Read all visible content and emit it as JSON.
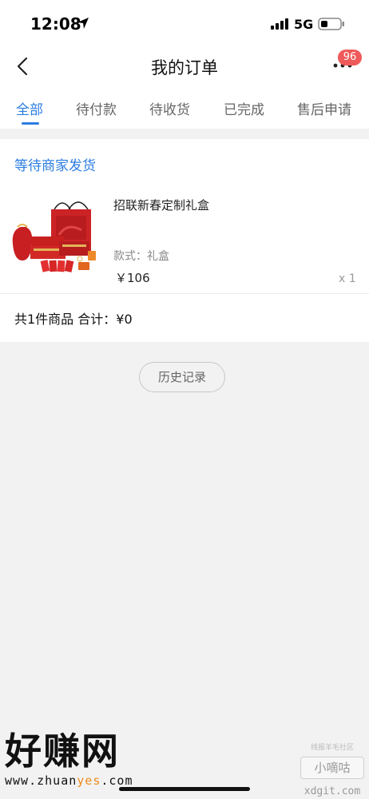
{
  "status_bar": {
    "time": "12:08",
    "network": "5G"
  },
  "nav": {
    "title": "我的订单",
    "badge_count": "96"
  },
  "tabs": [
    {
      "label": "全部",
      "active": true
    },
    {
      "label": "待付款",
      "active": false
    },
    {
      "label": "待收货",
      "active": false
    },
    {
      "label": "已完成",
      "active": false
    },
    {
      "label": "售后申请",
      "active": false
    }
  ],
  "order": {
    "status": "等待商家发货",
    "product": {
      "name": "招联新春定制礼盒",
      "spec": "款式：礼盒",
      "price": "￥106",
      "quantity": "x 1"
    },
    "summary": "共1件商品 合计：¥0"
  },
  "history_button": "历史记录",
  "watermark": {
    "left_title": "好赚网",
    "left_url_pre": "www.zhuan",
    "left_url_hl": "yes",
    "left_url_post": ".com",
    "right_small": "线报羊毛社区",
    "right_box": "小嘀咕",
    "right_domain": "xdgit.com"
  },
  "colors": {
    "accent": "#2b7de1",
    "badge": "#f05a5a",
    "product_red": "#d42a2a"
  }
}
